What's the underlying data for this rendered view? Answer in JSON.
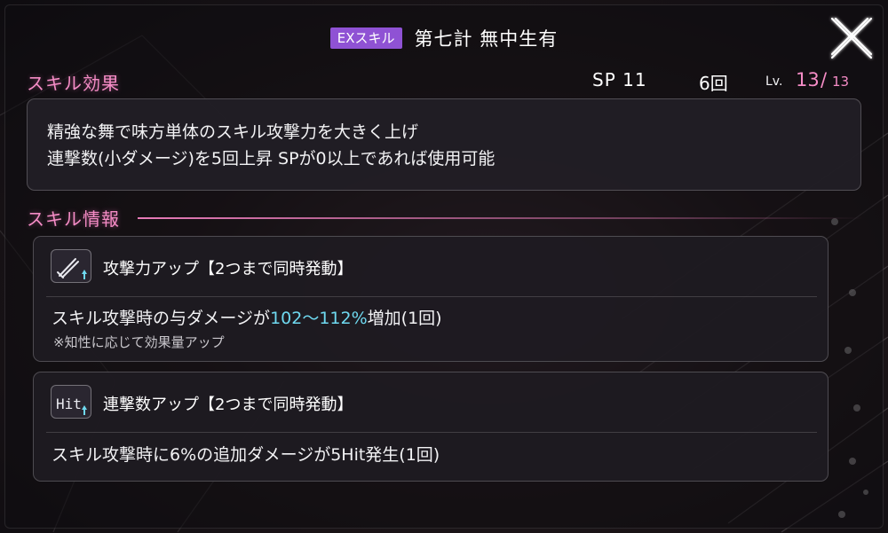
{
  "header": {
    "badge": "EXスキル",
    "skill_name": "第七計 無中生有"
  },
  "sections": {
    "effect_heading": "スキル効果",
    "info_heading": "スキル情報"
  },
  "stats": {
    "sp": "SP 11",
    "uses": "6回",
    "level_label": "Lv.",
    "level_current": "13",
    "level_slash": "/",
    "level_max": "13"
  },
  "description": {
    "line1": "精強な舞で味方単体のスキル攻撃力を大きく上げ",
    "line2": "連撃数(小ダメージ)を5回上昇 SPが0以上であれば使用可能"
  },
  "effects": [
    {
      "icon": "sword-up-icon",
      "title": "攻撃力アップ【2つまで同時発動】",
      "body_prefix": "スキル攻撃時の与ダメージが",
      "body_highlight": "102～112%",
      "body_suffix": "増加(1回)",
      "note": "※知性に応じて効果量アップ"
    },
    {
      "icon": "hit-up-icon",
      "icon_text": "Hit",
      "title": "連撃数アップ【2つまで同時発動】",
      "body": "スキル攻撃時に6%の追加ダメージが5Hit発生(1回)"
    }
  ],
  "colors": {
    "accent_pink": "#f58cc6",
    "badge_purple": "#8f52d4",
    "highlight_cyan": "#6fd9f0"
  }
}
